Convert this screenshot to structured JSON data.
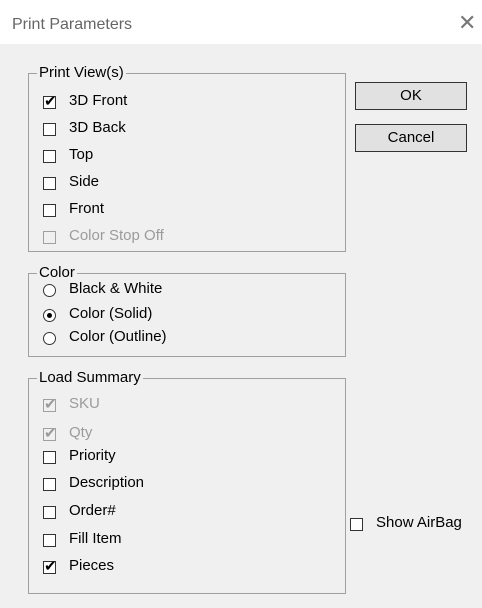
{
  "window": {
    "title": "Print Parameters",
    "close_symbol": "✕"
  },
  "buttons": {
    "ok": "OK",
    "cancel": "Cancel"
  },
  "print_views": {
    "legend": "Print View(s)",
    "items": [
      {
        "label": "3D Front",
        "checked": true,
        "enabled": true
      },
      {
        "label": "3D Back",
        "checked": false,
        "enabled": true
      },
      {
        "label": "Top",
        "checked": false,
        "enabled": true
      },
      {
        "label": "Side",
        "checked": false,
        "enabled": true
      },
      {
        "label": "Front",
        "checked": false,
        "enabled": true
      },
      {
        "label": "Color Stop Off",
        "checked": false,
        "enabled": false
      }
    ]
  },
  "color": {
    "legend": "Color",
    "options": [
      {
        "label": "Black & White",
        "selected": false
      },
      {
        "label": "Color (Solid)",
        "selected": true
      },
      {
        "label": "Color (Outline)",
        "selected": false
      }
    ]
  },
  "load_summary": {
    "legend": "Load Summary",
    "items": [
      {
        "label": "SKU",
        "checked": true,
        "enabled": false
      },
      {
        "label": "Qty",
        "checked": true,
        "enabled": false
      },
      {
        "label": "Priority",
        "checked": false,
        "enabled": true
      },
      {
        "label": "Description",
        "checked": false,
        "enabled": true
      },
      {
        "label": "Order#",
        "checked": false,
        "enabled": true
      },
      {
        "label": "Fill Item",
        "checked": false,
        "enabled": true
      },
      {
        "label": "Pieces",
        "checked": true,
        "enabled": true
      }
    ]
  },
  "show_airbag": {
    "label": "Show AirBag",
    "checked": false
  }
}
